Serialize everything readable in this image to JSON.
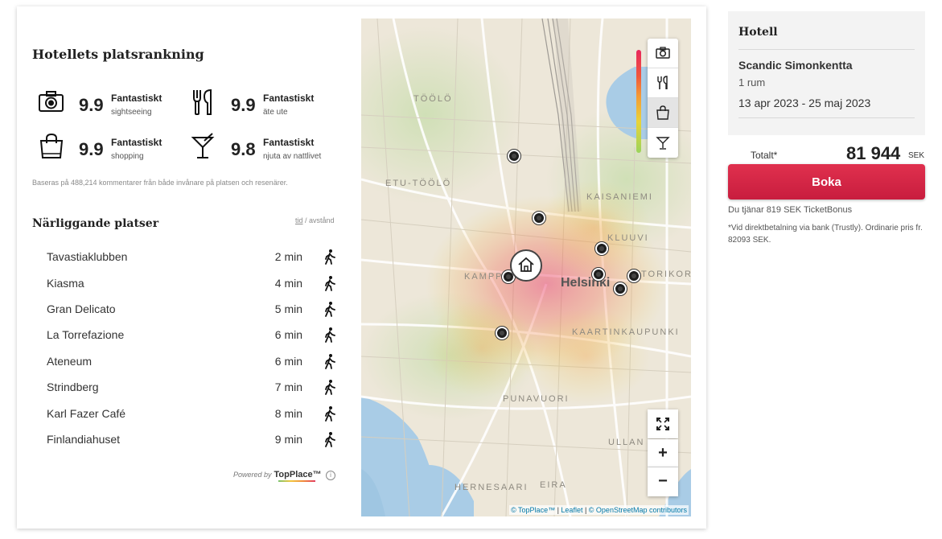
{
  "ranking": {
    "title": "Hotellets platsrankning",
    "items": [
      {
        "icon": "camera-icon",
        "score": "9.9",
        "label": "Fantastiskt",
        "sub": "sightseeing"
      },
      {
        "icon": "cutlery-icon",
        "score": "9.9",
        "label": "Fantastiskt",
        "sub": "äte ute"
      },
      {
        "icon": "shopping-bag-icon",
        "score": "9.9",
        "label": "Fantastiskt",
        "sub": "shopping"
      },
      {
        "icon": "cocktail-icon",
        "score": "9.8",
        "label": "Fantastiskt",
        "sub": "njuta av nattlivet"
      }
    ],
    "note": "Baseras på 488,214 kommentarer från både invånare på platsen och resenärer."
  },
  "nearby": {
    "title": "Närliggande platser",
    "sort_active": "tid",
    "sort_sep": " / ",
    "sort_other": "avstånd",
    "places": [
      {
        "name": "Tavastiaklubben",
        "time": "2 min"
      },
      {
        "name": "Kiasma",
        "time": "4 min"
      },
      {
        "name": "Gran Delicato",
        "time": "5 min"
      },
      {
        "name": "La Torrefazione",
        "time": "6 min"
      },
      {
        "name": "Ateneum",
        "time": "6 min"
      },
      {
        "name": "Strindberg",
        "time": "7 min"
      },
      {
        "name": "Karl Fazer Café",
        "time": "8 min"
      },
      {
        "name": "Finlandiahuset",
        "time": "9 min"
      }
    ]
  },
  "powered": {
    "prefix": "Powered by",
    "brand": "TopPlace™",
    "info": "i"
  },
  "map": {
    "labels": {
      "toolo": "TÖÖLÖ",
      "etu_toolo": "ETU-TÖÖLÖ",
      "kaisaniemi": "KAISANIEMI",
      "kluuvi": "KLUUVI",
      "kamppi": "KAMPPI",
      "torikor": "TORIKOR",
      "helsinki": "Helsinki",
      "kaartinkaupunki": "KAARTINKAUPUNKI",
      "punavuori": "PUNAVUORI",
      "ullan": "ULLAN",
      "hernesaari": "HERNESAARI",
      "eira": "EIRA"
    },
    "zoom_in": "+",
    "zoom_out": "−",
    "attribution": {
      "topplace": "© TopPlace™",
      "leaflet": "Leaflet",
      "osm": "© OpenStreetMap contributors",
      "sep": " | "
    },
    "heat_colors": [
      "#e8285e",
      "#f0553d",
      "#f49b36",
      "#e9d43a",
      "#9ad45c"
    ]
  },
  "booking": {
    "heading": "Hotell",
    "hotel": "Scandic Simonkentta",
    "rooms": "1 rum",
    "dates": "13 apr 2023 - 25 maj 2023",
    "total_label": "Totalt*",
    "total_value": "81 944",
    "currency": "SEK",
    "book_label": "Boka",
    "bonus": "Du tjänar 819 SEK TicketBonus",
    "fine_print": "*Vid direktbetalning via bank (Trustly). Ordinarie pris fr. 82093 SEK.",
    "accent": "#d4203f"
  }
}
